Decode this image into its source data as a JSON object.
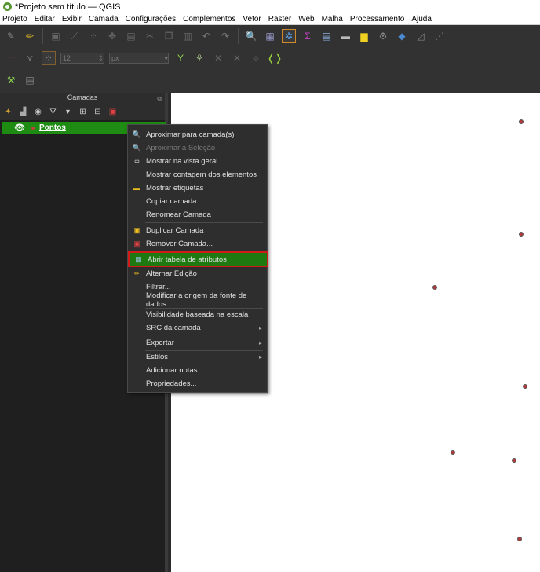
{
  "window": {
    "title": "*Projeto sem título — QGIS"
  },
  "menubar": [
    "Projeto",
    "Editar",
    "Exibir",
    "Camada",
    "Configurações",
    "Complementos",
    "Vetor",
    "Raster",
    "Web",
    "Malha",
    "Processamento",
    "Ajuda"
  ],
  "toolbar": {
    "font_size_value": "12",
    "unit_value": "px"
  },
  "layers_panel": {
    "title": "Camadas",
    "layers": [
      {
        "name": "Pontos",
        "visible": true,
        "selected": true
      }
    ]
  },
  "context_menu": {
    "items": [
      {
        "label": "Aproximar para camada(s)",
        "icon": "zoom-layer-icon",
        "enabled": true
      },
      {
        "label": "Aproximar à Seleção",
        "icon": "zoom-selection-icon",
        "enabled": false
      },
      {
        "label": "Mostrar na vista geral",
        "icon": "overview-icon",
        "enabled": true
      },
      {
        "label": "Mostrar contagem dos elementos",
        "icon": "",
        "enabled": true
      },
      {
        "label": "Mostrar etiquetas",
        "icon": "labels-icon",
        "enabled": true
      },
      {
        "label": "Copiar camada",
        "icon": "",
        "enabled": true
      },
      {
        "label": "Renomear Camada",
        "icon": "",
        "enabled": true
      },
      {
        "label": "Duplicar Camada",
        "icon": "duplicate-icon",
        "enabled": true
      },
      {
        "label": "Remover Camada...",
        "icon": "remove-icon",
        "enabled": true
      },
      {
        "label": "Abrir tabela de atributos",
        "icon": "table-icon",
        "enabled": true,
        "highlighted": true
      },
      {
        "label": "Alternar Edição",
        "icon": "pencil-icon",
        "enabled": true
      },
      {
        "label": "Filtrar...",
        "icon": "",
        "enabled": true
      },
      {
        "label": "Modificar a origem da fonte de dados",
        "icon": "",
        "enabled": true
      },
      {
        "label": "Visibilidade baseada na escala",
        "icon": "",
        "enabled": true
      },
      {
        "label": "SRC da camada",
        "icon": "",
        "enabled": true,
        "submenu": true
      },
      {
        "label": "Exportar",
        "icon": "",
        "enabled": true,
        "submenu": true
      },
      {
        "label": "Estilos",
        "icon": "",
        "enabled": true,
        "submenu": true
      },
      {
        "label": "Adicionar notas...",
        "icon": "",
        "enabled": true
      },
      {
        "label": "Propriedades...",
        "icon": "",
        "enabled": true
      }
    ]
  },
  "colors": {
    "selection_green": "#1e8c12",
    "highlight_border": "#d11a1a",
    "point_fill": "#b23a3a"
  }
}
